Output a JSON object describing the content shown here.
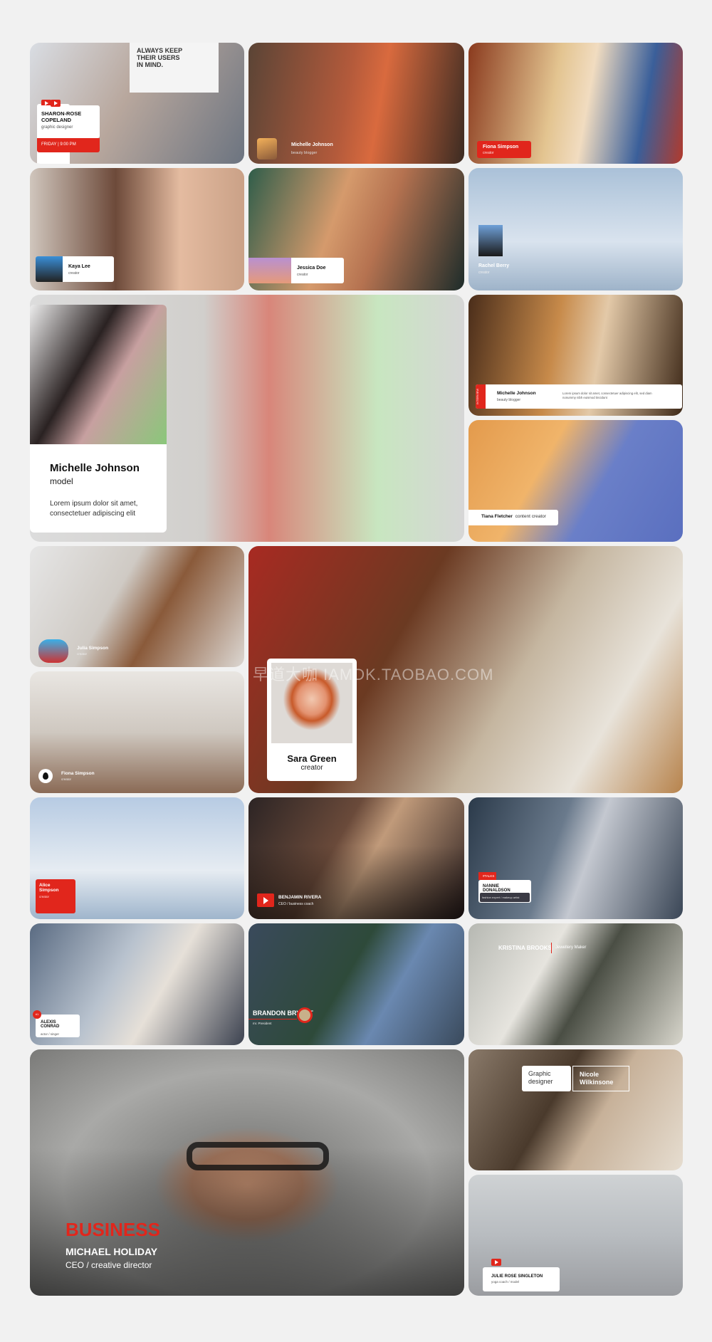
{
  "tiles": [
    {
      "name": "SHARON-ROSE COPELAND",
      "role": "graphic designer",
      "schedule": "FRIDAY | 9:00 PM",
      "background_text": "ALWAYS KEEP THEIR USERS IN MIND."
    },
    {
      "name": "Michelle Johnson",
      "role": "beauty blogger"
    },
    {
      "name": "Fiona Simpson",
      "role": "creator"
    },
    {
      "name": "Kaya Lee",
      "role": "creator"
    },
    {
      "name": "Jessica Doe",
      "role": "creator"
    },
    {
      "name": "Rachel Berry",
      "role": "creator"
    },
    {
      "name": "Michelle Johnson",
      "role": "model",
      "desc": "Lorem ipsum dolor sit amet, consectetuer adipiscing elit"
    },
    {
      "name": "Michelle Johnson",
      "role": "beauty blogger",
      "tag": "INTERVIEW",
      "desc": "Lorem ipsum dolor sit amet, consectetuer adipiscing elit, sed diam nonummy nibh euismod tincidunt"
    },
    {
      "name": "Tiana Fletcher",
      "role": "content creator"
    },
    {
      "name": "Julia Simpson",
      "role": "creator"
    },
    {
      "name": "Fiona Simpson",
      "role": "creator"
    },
    {
      "name": "Sara Green",
      "role": "creator"
    },
    {
      "name": "Alice Simpson",
      "role": "creator"
    },
    {
      "name": "BENJAMIN RIVERA",
      "role": "CEO / business coach"
    },
    {
      "name": "NANNIE DONALDSON",
      "role": "fashion expert / makeup artist",
      "tag": "#TALKS"
    },
    {
      "name": "ALEXIS CONRAD",
      "role": "actor / singer",
      "tag": "#1"
    },
    {
      "name": "BRANDON BRYANT",
      "role": "mr. President"
    },
    {
      "name": "KRISTINA BROOKS",
      "role": "Jewellery Maker"
    },
    {
      "name": "MICHAEL HOLIDAY",
      "role": "CEO / creative director",
      "tag": "BUSINESS"
    },
    {
      "name": "Nicole Wilkinsone",
      "role": "Graphic designer"
    },
    {
      "name": "JULIE ROSE SINGLETON",
      "role": "yoga coach / model"
    }
  ],
  "watermark": "早道大咖 IAMDK.TAOBAO.COM",
  "colors": {
    "accent": "#e1261c",
    "background": "#f1f1f1"
  }
}
